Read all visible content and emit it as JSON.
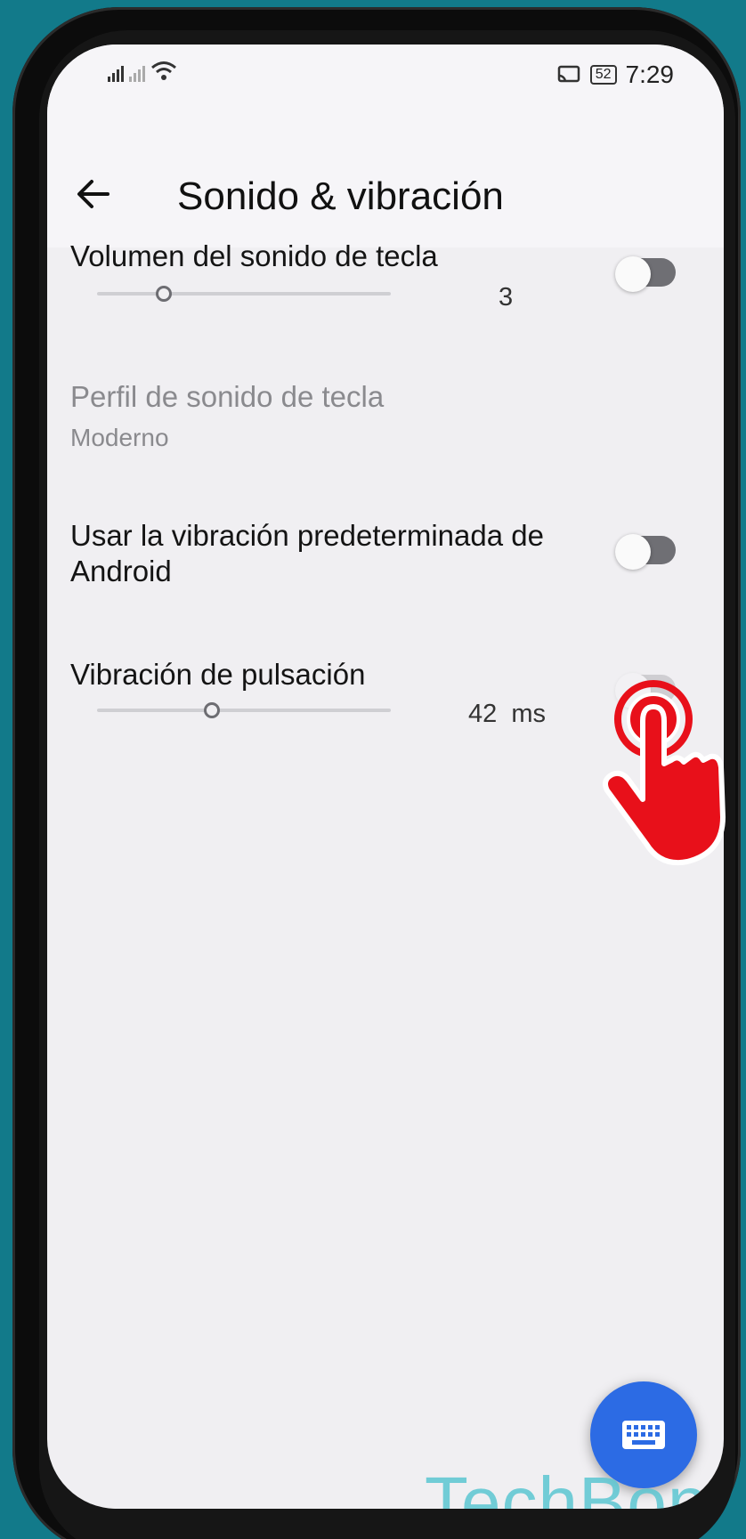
{
  "statusbar": {
    "time": "7:29",
    "battery": "52",
    "signal_icon": "signal-bars-icon",
    "wifi_icon": "wifi-icon",
    "cast_icon": "cast-icon"
  },
  "header": {
    "title": "Sonido & vibración",
    "back_icon": "arrow-left-icon"
  },
  "settings": [
    {
      "label": "Volumen del sonido de tecla",
      "slider_value": "3",
      "slider_fraction": 0.25,
      "toggle": "off"
    },
    {
      "label": "Perfil de sonido de tecla",
      "subtitle": "Moderno",
      "enabled": false
    },
    {
      "label_line1": "Usar la vibración predeterminada de",
      "label_line2": "Android",
      "toggle": "off"
    },
    {
      "label": "Vibración de pulsación",
      "slider_value": "42",
      "slider_unit": "ms",
      "slider_fraction": 0.41,
      "toggle": "off"
    }
  ],
  "fab": {
    "icon": "keyboard-icon"
  },
  "watermark": "TechBone",
  "colors": {
    "accent": "#2c6be4",
    "tap_indicator": "#e8101a",
    "background": "#127a8a"
  }
}
